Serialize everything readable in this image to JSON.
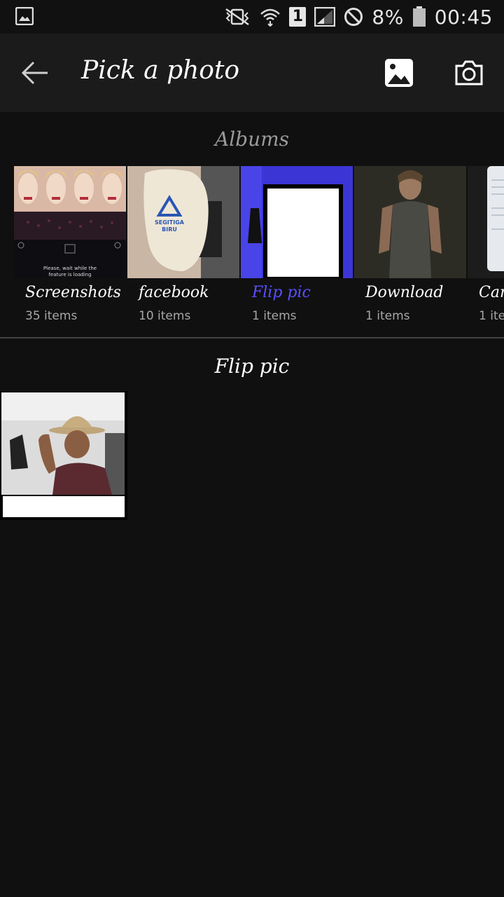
{
  "status_bar": {
    "battery_text": "8%",
    "time": "00:45",
    "sim_slot": "1",
    "icons": [
      "gallery-notification-icon",
      "vibrate-icon",
      "wifi-icon",
      "sim-icon",
      "signal-icon",
      "do-not-disturb-icon",
      "battery-icon"
    ]
  },
  "app_bar": {
    "title": "Pick a photo",
    "icons": [
      "back-arrow-icon",
      "gallery-icon",
      "camera-icon"
    ]
  },
  "albums": {
    "title": "Albums",
    "items": [
      {
        "name": "Screenshots",
        "count": "35 items",
        "selected": false,
        "thumb_caption": "Please, wait while the feature is loading"
      },
      {
        "name": "facebook",
        "count": "10 items",
        "selected": false,
        "thumb_caption": "SEGITIGA BIRU"
      },
      {
        "name": "Flip pic",
        "count": "1 items",
        "selected": true
      },
      {
        "name": "Download",
        "count": "1 items",
        "selected": false
      },
      {
        "name": "Can",
        "count": "1 ite",
        "selected": false
      }
    ]
  },
  "current_album": {
    "title": "Flip pic",
    "photo_count": 1
  },
  "colors": {
    "background": "#101010",
    "app_bar": "#1b1b1b",
    "accent": "#5a4fff"
  }
}
